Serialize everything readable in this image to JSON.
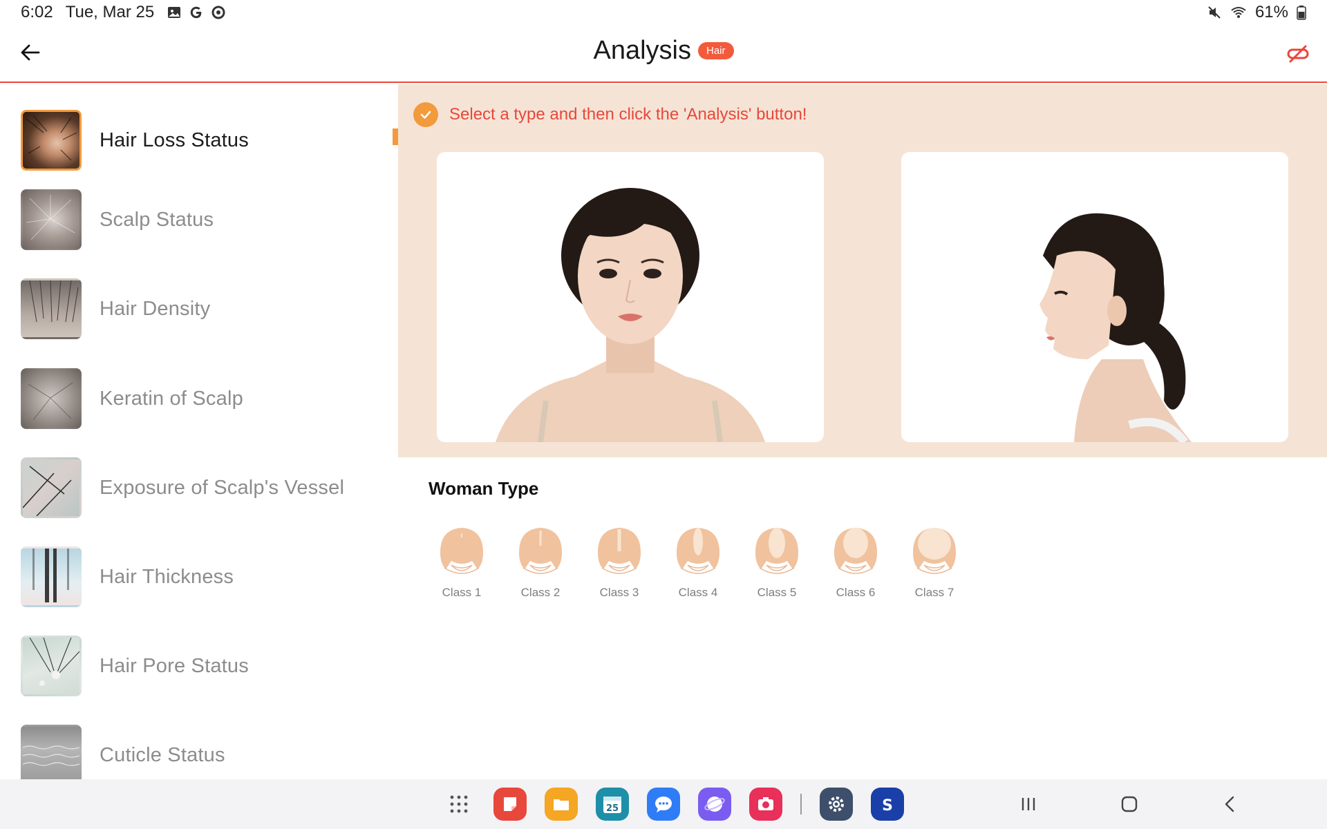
{
  "status_bar": {
    "time": "6:02",
    "date": "Tue, Mar 25",
    "notification_icons": [
      "gallery-icon",
      "google-icon",
      "sync-icon"
    ],
    "battery": "61%",
    "status_icons": [
      "mute-icon",
      "wifi-icon",
      "battery-icon"
    ]
  },
  "header": {
    "title": "Analysis",
    "badge": "Hair",
    "accent_color": "#e8473b"
  },
  "sidebar": {
    "items": [
      {
        "label": "Hair Loss Status",
        "active": true
      },
      {
        "label": "Scalp Status",
        "active": false
      },
      {
        "label": "Hair Density",
        "active": false
      },
      {
        "label": "Keratin of Scalp",
        "active": false
      },
      {
        "label": "Exposure of Scalp's Vessel",
        "active": false
      },
      {
        "label": "Hair Thickness",
        "active": false
      },
      {
        "label": "Hair Pore Status",
        "active": false
      },
      {
        "label": "Cuticle Status",
        "active": false
      }
    ]
  },
  "main": {
    "hint": "Select a type and then click the 'Analysis' button!",
    "section_title": "Woman Type",
    "classes": [
      "Class 1",
      "Class 2",
      "Class 3",
      "Class 4",
      "Class 5",
      "Class 6",
      "Class 7"
    ],
    "guide_bg": "#f5e4d5",
    "accent_orange": "#f39a3c"
  },
  "navbar": {
    "dock_apps": [
      "apps-grid-icon",
      "notes-app-icon",
      "files-app-icon",
      "calendar-app-icon",
      "messages-app-icon",
      "internet-app-icon",
      "camera-app-icon",
      "settings-app-icon",
      "samsung-app-icon"
    ],
    "calendar_day": "25"
  }
}
